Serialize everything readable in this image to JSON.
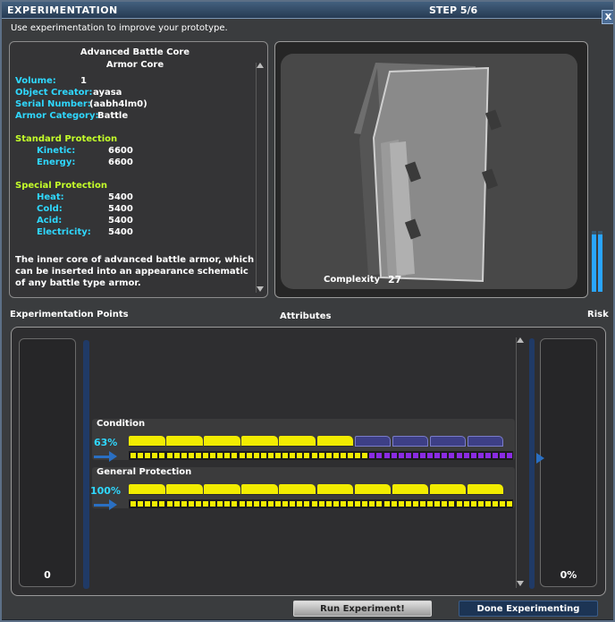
{
  "window": {
    "title": "EXPERIMENTATION",
    "step": "STEP 5/6",
    "close_glyph": "x"
  },
  "instructions": "Use experimentation to improve your prototype.",
  "item": {
    "name": "Advanced Battle Core",
    "type": "Armor Core",
    "props": [
      {
        "label": "Volume:",
        "value": "1"
      },
      {
        "label": "Object Creator:",
        "value": "ayasa"
      },
      {
        "label": "Serial Number:",
        "value": "(aabh4lm0)"
      },
      {
        "label": "Armor Category:",
        "value": "Battle"
      }
    ],
    "standard": {
      "heading": "Standard Protection",
      "rows": [
        {
          "label": "Kinetic:",
          "value": "6600"
        },
        {
          "label": "Energy:",
          "value": "6600"
        }
      ]
    },
    "special": {
      "heading": "Special Protection",
      "rows": [
        {
          "label": "Heat:",
          "value": "5400"
        },
        {
          "label": "Cold:",
          "value": "5400"
        },
        {
          "label": "Acid:",
          "value": "5400"
        },
        {
          "label": "Electricity:",
          "value": "5400"
        }
      ]
    },
    "description": "The inner core of advanced battle armor, which can be inserted into an appearance schematic of any battle type armor."
  },
  "preview": {
    "complexity_label": "Complexity",
    "complexity_value": "27",
    "progress_cells_lit": 16
  },
  "headers": {
    "experimentation_points": "Experimentation Points",
    "attributes": "Attributes",
    "risk": "Risk"
  },
  "experimentation_points_value": "0",
  "risk_value": "0%",
  "attributes": [
    {
      "name": "Condition",
      "percent_text": "63%",
      "filled_segments": 6,
      "total_segments": 10,
      "fraction": 0.63
    },
    {
      "name": "General Protection",
      "percent_text": "100%",
      "filled_segments": 10,
      "total_segments": 10,
      "fraction": 1.0
    }
  ],
  "buttons": {
    "run": "Run Experiment!",
    "done": "Done Experimenting"
  },
  "colors": {
    "label": "#2fd8ff",
    "section": "#c4ff2a",
    "bar_filled": "#f2ec00",
    "bar_empty": "#3d3f86",
    "strip_filled": "#f2ec00",
    "strip_risk": "#8a2be2",
    "accent": "#2a6fc2"
  }
}
